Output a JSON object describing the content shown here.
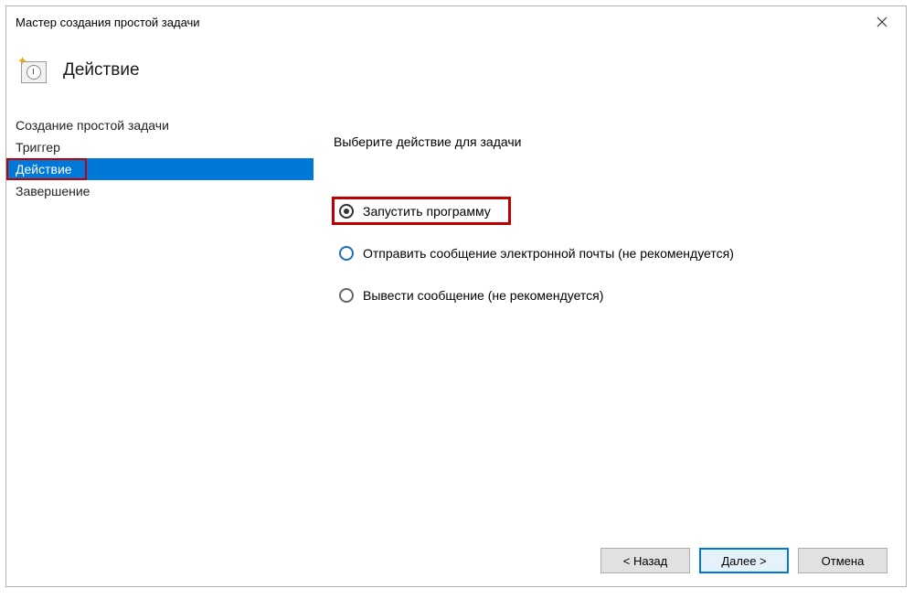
{
  "titlebar": {
    "title": "Мастер создания простой задачи"
  },
  "header": {
    "title": "Действие"
  },
  "sidebar": {
    "items": [
      {
        "label": "Создание простой задачи"
      },
      {
        "label": "Триггер"
      },
      {
        "label": "Действие"
      },
      {
        "label": "Завершение"
      }
    ]
  },
  "main": {
    "instruction": "Выберите действие для задачи",
    "options": [
      {
        "label": "Запустить программу"
      },
      {
        "label": "Отправить сообщение электронной почты (не рекомендуется)"
      },
      {
        "label": "Вывести сообщение (не рекомендуется)"
      }
    ]
  },
  "footer": {
    "back": "< Назад",
    "next": "Далее >",
    "cancel": "Отмена"
  }
}
